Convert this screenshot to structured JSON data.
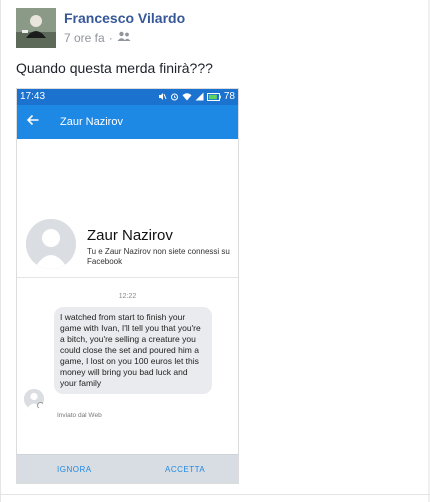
{
  "post": {
    "author": "Francesco Vilardo",
    "time_ago": "7 ore fa",
    "separator": "·",
    "audience_icon": "friends-icon",
    "status_text": "Quando questa merda finirà???"
  },
  "screenshot": {
    "statusbar": {
      "time": "17:43",
      "battery": "78",
      "icons": [
        "mute-icon",
        "alarm-icon",
        "wifi-icon",
        "signal-icon",
        "battery-icon"
      ]
    },
    "toolbar": {
      "back_icon": "back-arrow-icon",
      "title": "Zaur Nazirov"
    },
    "profile": {
      "name": "Zaur Nazirov",
      "subtitle": "Tu e Zaur Nazirov non siete connessi su Facebook"
    },
    "message": {
      "time": "12:22",
      "text": "I watched from start to finish your game with Ivan, I'll tell you that you're a bitch, you're selling a creature you could close the set and poured him a game, I lost on you 100 euros let this money will bring you bad luck and your family",
      "sent_via": "Inviato dal Web"
    },
    "actions": {
      "ignore": "IGNORA",
      "accept": "ACCETTA"
    }
  },
  "colors": {
    "author_link": "#365899",
    "toolbar": "#1e88e5",
    "statusbar": "#1c72cf",
    "action_text": "#1e88e5"
  }
}
